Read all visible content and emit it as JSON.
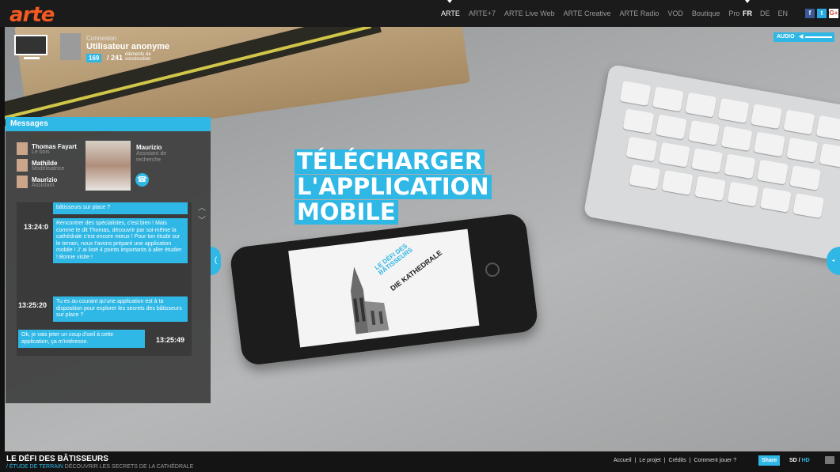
{
  "header": {
    "logo": "arte",
    "nav": [
      "ARTE",
      "ARTE+7",
      "ARTE Live Web",
      "ARTE Creative",
      "ARTE Radio",
      "VOD",
      "Boutique",
      "Pro"
    ],
    "languages": [
      "FR",
      "DE",
      "EN"
    ],
    "social": [
      "f",
      "t",
      "G+"
    ]
  },
  "user": {
    "connexion_label": "Connexion",
    "name": "Utilisateur anonyme",
    "count": "169",
    "total": "/ 241",
    "count_label": "éléments de construction"
  },
  "audio": {
    "label": "AUDIO"
  },
  "messages": {
    "title": "Messages",
    "contacts": [
      {
        "name": "Thomas Fayart",
        "role": "Le bois"
      },
      {
        "name": "Mathilde",
        "role": "Modélisatrice"
      },
      {
        "name": "Maurizio",
        "role": "Assistant"
      }
    ],
    "speaker": {
      "name": "Maurizio",
      "role": "Assistant de recherche"
    },
    "chat": {
      "top_fragment": "bâtisseurs sur place ?",
      "msg1_time": "13:24:0",
      "msg1_text": "Rencontrer des spécialistes, c'est bien ! Mais comme le dit Thomas, découvrir par soi-même la cathédrale c'est encore mieux ! Pour ton étude sur le terrain, nous t'avons préparé une application mobile ! J' ai listé 4 points importants à aller étudier ! Bonne visite !",
      "msg2_time": "13:25:20",
      "msg2_text": "Tu es au courant qu'une application est à ta disposition pour explorer les secrets des bâtisseurs sur place ?",
      "msg3_time": "13:25:49",
      "msg3_text": "Ok, je vais jeter un coup d'oeil à cette application, ça m'intéresse."
    }
  },
  "headline": [
    "TÉLÉCHARGER",
    "L'APPLICATION",
    "MOBILE"
  ],
  "phone_screen": {
    "line1": "LE DÉFI DES BÂTISSEURS",
    "line2": "DIE KATHEDRALE"
  },
  "footer": {
    "title": "LE DÉFI DES BÂTISSEURS",
    "crumb_prefix": "/ ÉTUDE DE TERRAIN",
    "crumb_rest": "DÉCOUVRIR LES SECRETS DE LA CATHÉDRALE",
    "links": [
      "Accueil",
      "|",
      "Le projet",
      "|",
      "Crédits",
      "|",
      "Comment jouer ?"
    ],
    "share": "Share",
    "quality_sd": "SD",
    "quality_sep": "/",
    "quality_hd": "HD"
  },
  "colors": {
    "accent": "#2fb7e5",
    "logo": "#f15a22"
  }
}
